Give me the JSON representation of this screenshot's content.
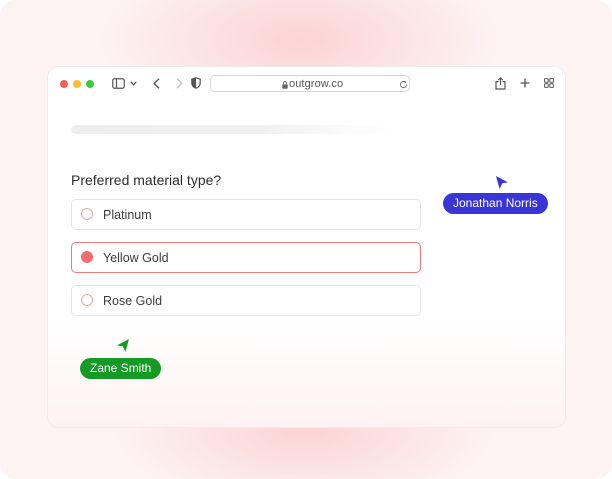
{
  "browser": {
    "url": "outgrow.co",
    "icons": {
      "sidebar": "sidebar-icon",
      "chevron": "chevron-down-icon",
      "back": "back-arrow-icon",
      "forward": "forward-arrow-icon",
      "shield": "shield-icon",
      "lock": "lock-icon",
      "reload": "reload-icon",
      "share": "share-icon",
      "new_tab": "plus-icon",
      "tabs": "tab-overview-icon"
    }
  },
  "quiz": {
    "progress": 0.0,
    "question": "Preferred material type?",
    "options": [
      {
        "label": "Platinum",
        "selected": false
      },
      {
        "label": "Yellow Gold",
        "selected": true
      },
      {
        "label": "Rose Gold",
        "selected": false
      }
    ]
  },
  "cursors": [
    {
      "name": "Jonathan Norris",
      "color": "#3a35d6"
    },
    {
      "name": "Zane Smith",
      "color": "#159a26"
    }
  ],
  "colors": {
    "accent": "#f06c70",
    "background": "#fdf3f3"
  }
}
